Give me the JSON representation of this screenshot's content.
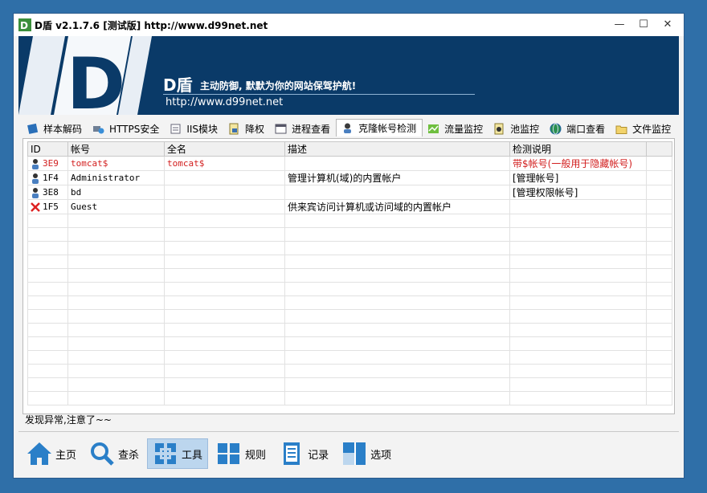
{
  "window": {
    "title": "D盾 v2.1.7.6 [测试版] http://www.d99net.net",
    "minimize": "—",
    "maximize": "☐",
    "close": "✕"
  },
  "banner": {
    "brand": "D盾",
    "slogan": "主动防御, 默默为你的网站保驾护航!",
    "url": "http://www.d99net.net"
  },
  "tabs": [
    {
      "label": "样本解码",
      "icon": "book-icon"
    },
    {
      "label": "HTTPS安全",
      "icon": "network-icon"
    },
    {
      "label": "IIS模块",
      "icon": "module-icon"
    },
    {
      "label": "降权",
      "icon": "lock-doc-icon"
    },
    {
      "label": "进程查看",
      "icon": "window-icon"
    },
    {
      "label": "克隆帐号检测",
      "icon": "user-icon",
      "active": true
    },
    {
      "label": "流量监控",
      "icon": "traffic-icon"
    },
    {
      "label": "池监控",
      "icon": "pool-icon"
    },
    {
      "label": "端口查看",
      "icon": "globe-icon"
    },
    {
      "label": "文件监控",
      "icon": "folder-icon"
    }
  ],
  "table": {
    "columns": [
      "ID",
      "帐号",
      "全名",
      "描述",
      "检测说明"
    ],
    "rows": [
      {
        "id": "3E9",
        "account": "tomcat$",
        "fullname": "tomcat$",
        "description": "",
        "note": "带$帐号(一般用于隐藏帐号)",
        "icon": "user-icon",
        "highlight": true
      },
      {
        "id": "1F4",
        "account": "Administrator",
        "fullname": "",
        "description": "管理计算机(域)的内置帐户",
        "note": "[管理帐号]",
        "icon": "user-icon",
        "highlight": false
      },
      {
        "id": "3E8",
        "account": "bd",
        "fullname": "",
        "description": "",
        "note": "[管理权限帐号]",
        "icon": "user-icon",
        "highlight": false
      },
      {
        "id": "1F5",
        "account": "Guest",
        "fullname": "",
        "description": "供来宾访问计算机或访问域的内置帐户",
        "note": "",
        "icon": "disabled-icon",
        "highlight": false
      }
    ]
  },
  "status": "发现异常,注意了~~",
  "bottom_nav": [
    {
      "label": "主页",
      "icon": "home-icon"
    },
    {
      "label": "查杀",
      "icon": "search-icon"
    },
    {
      "label": "工具",
      "icon": "tools-icon",
      "selected": true
    },
    {
      "label": "规则",
      "icon": "grid-icon"
    },
    {
      "label": "记录",
      "icon": "log-icon"
    },
    {
      "label": "选项",
      "icon": "options-icon"
    }
  ],
  "colors": {
    "accent": "#2a7fc8",
    "alert": "#d21e1e",
    "banner": "#0a3a68",
    "desktop": "#2f6fa8"
  }
}
